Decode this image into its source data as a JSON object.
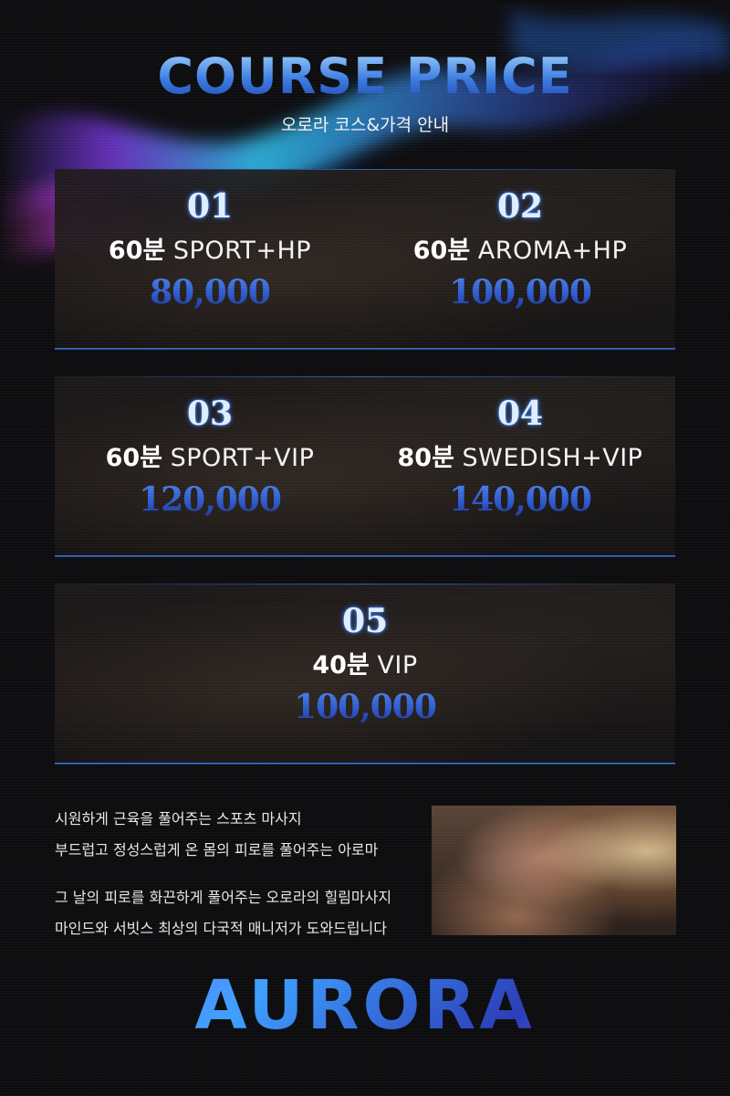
{
  "header": {
    "title": "COURSE PRICE",
    "subtitle": "오로라 코스&가격 안내"
  },
  "courses": [
    {
      "number": "01",
      "minutes": "60분",
      "type": "SPORT+HP",
      "price": "80,000"
    },
    {
      "number": "02",
      "minutes": "60분",
      "type": "AROMA+HP",
      "price": "100,000"
    },
    {
      "number": "03",
      "minutes": "60분",
      "type": "SPORT+VIP",
      "price": "120,000"
    },
    {
      "number": "04",
      "minutes": "80분",
      "type": "SWEDISH+VIP",
      "price": "140,000"
    },
    {
      "number": "05",
      "minutes": "40분",
      "type": "VIP",
      "price": "100,000"
    }
  ],
  "description": {
    "lines": [
      "시원하게 근육을 풀어주는 스포츠 마사지",
      "부드럽고 정성스럽게 온 몸의 피로를 풀어주는 아로마",
      "그 날의 피로를 화끈하게 풀어주는 오로라의 힐림마사지",
      "마인드와 서빗스 최상의 다국적 매니저가 도와드립니다"
    ]
  },
  "logo": {
    "text": "AURORA"
  },
  "colors": {
    "accent_blue": "#2f6fd8",
    "background": "#0d0d0f"
  }
}
